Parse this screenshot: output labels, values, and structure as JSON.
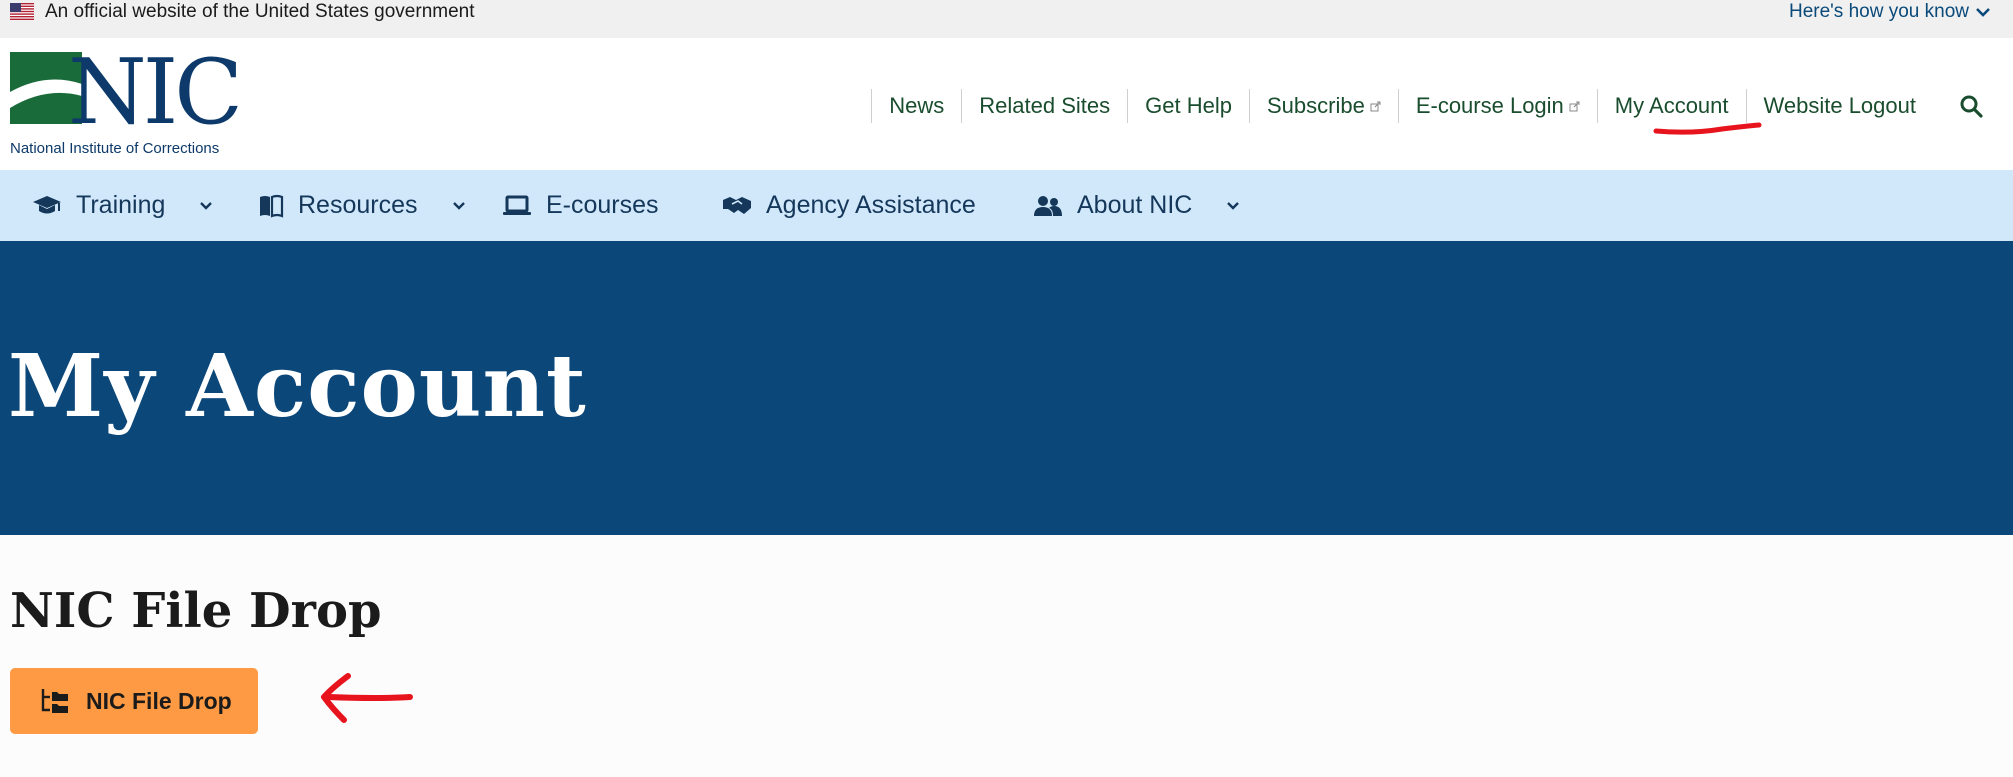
{
  "gov_banner": {
    "official_text": "An official website of the United States government",
    "how_you_know": "Here's how you know"
  },
  "logo": {
    "wordmark": "NIC",
    "caption": "National Institute of Corrections"
  },
  "top_nav": {
    "items": [
      {
        "label": "News",
        "external": false
      },
      {
        "label": "Related Sites",
        "external": false
      },
      {
        "label": "Get Help",
        "external": false
      },
      {
        "label": "Subscribe",
        "external": true
      },
      {
        "label": "E-course Login",
        "external": true
      },
      {
        "label": "My Account",
        "external": false
      },
      {
        "label": "Website Logout",
        "external": false
      }
    ],
    "search_icon": "search-icon"
  },
  "main_nav": {
    "items": [
      {
        "label": "Training",
        "icon": "graduation-cap-icon",
        "has_dropdown": true
      },
      {
        "label": "Resources",
        "icon": "book-icon",
        "has_dropdown": true
      },
      {
        "label": "E-courses",
        "icon": "laptop-icon",
        "has_dropdown": false
      },
      {
        "label": "Agency Assistance",
        "icon": "handshake-icon",
        "has_dropdown": false
      },
      {
        "label": "About NIC",
        "icon": "users-icon",
        "has_dropdown": true
      }
    ]
  },
  "hero": {
    "title": "My Account"
  },
  "content": {
    "section_title": "NIC File Drop",
    "file_drop_button": "NIC File Drop",
    "file_drop_icon": "folder-tree-icon"
  },
  "colors": {
    "gov_banner_bg": "#f0f0f0",
    "nav_text_green": "#1a4d2e",
    "main_nav_bg": "#d1e8fb",
    "hero_bg": "#0c4779",
    "button_orange": "#fd9a43",
    "annotation_red": "#e8141d",
    "logo_green": "#1a6b3a",
    "logo_blue": "#0d3a6a"
  }
}
